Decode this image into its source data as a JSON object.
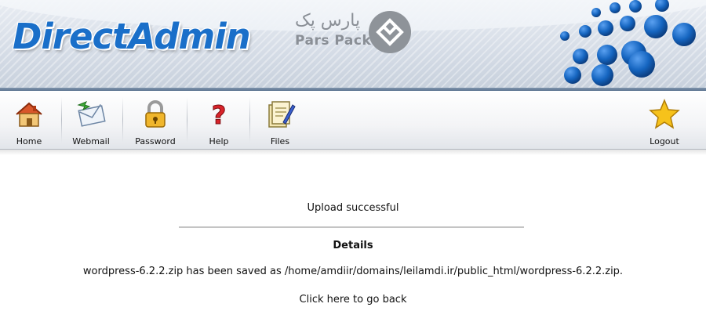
{
  "app": {
    "logo_text": "DirectAdmin",
    "brand_name_fa": "پارس پک",
    "brand_name_en": "Pars Pack"
  },
  "toolbar": {
    "items": [
      {
        "label": "Home",
        "icon": "home-icon"
      },
      {
        "label": "Webmail",
        "icon": "webmail-icon"
      },
      {
        "label": "Password",
        "icon": "lock-icon"
      },
      {
        "label": "Help",
        "icon": "help-icon"
      },
      {
        "label": "Files",
        "icon": "files-icon"
      }
    ],
    "logout": {
      "label": "Logout",
      "icon": "star-icon"
    }
  },
  "main": {
    "status": "Upload successful",
    "details_heading": "Details",
    "details_text": "wordpress-6.2.2.zip has been saved as /home/amdiir/domains/leilamdi.ir/public_html/wordpress-6.2.2.zip.",
    "back_link": "Click here to go back"
  },
  "colors": {
    "logo": "#1a6fc9",
    "bubbles": "#1565c0",
    "banner": "#d6dde7"
  }
}
